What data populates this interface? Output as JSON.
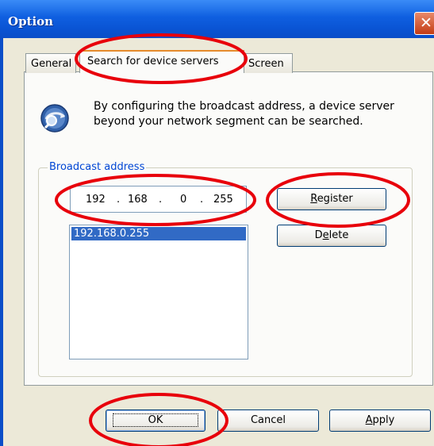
{
  "window": {
    "title": "Option",
    "close_glyph": "✕"
  },
  "tabs": [
    {
      "label": "General",
      "selected": false
    },
    {
      "label": "Search for device servers",
      "selected": true
    },
    {
      "label": "Screen",
      "selected": false
    }
  ],
  "info": {
    "icon": "search-globe-icon",
    "text": "By configuring the broadcast address, a device server beyond your network segment can be searched."
  },
  "broadcast": {
    "group_label": "Broadcast address",
    "ip_octets": [
      "192",
      "168",
      "0",
      "255"
    ],
    "ip_separator": ".",
    "list_items": [
      "192.168.0.255"
    ],
    "selected_index": 0
  },
  "buttons": {
    "register": "Register",
    "delete": "Delete",
    "ok": "OK",
    "cancel": "Cancel",
    "apply": "Apply"
  },
  "colors": {
    "titlebar": "#0a54d4",
    "highlight": "#316ac5",
    "annotation": "#e8000b",
    "groupbox_label": "#0046d5"
  }
}
